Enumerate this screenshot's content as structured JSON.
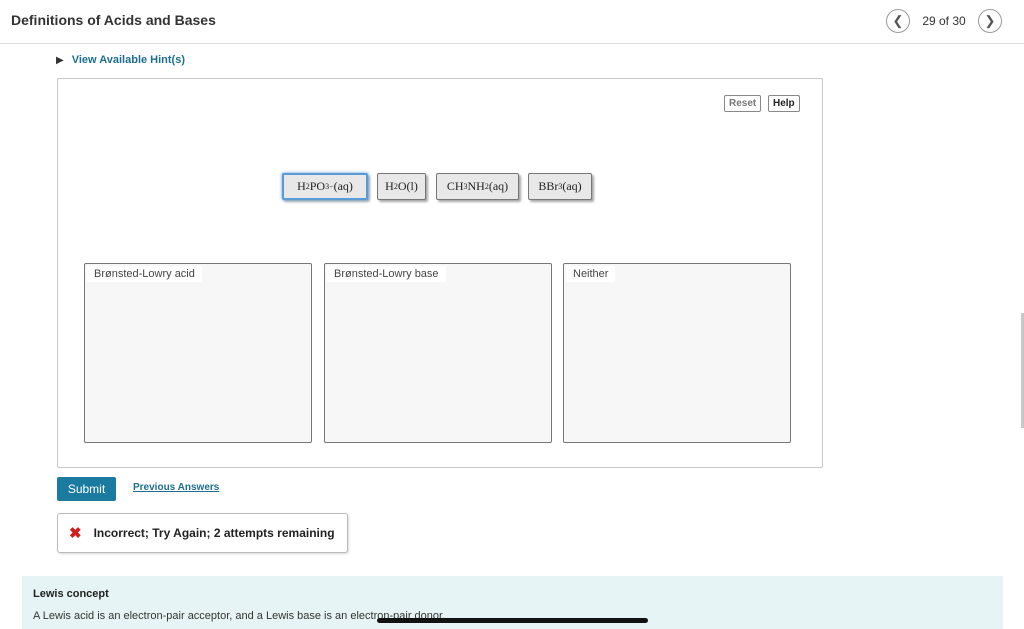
{
  "header": {
    "title": "Definitions of Acids and Bases",
    "page_count": "29 of 30",
    "prev_icon": "chevron-left-icon",
    "next_icon": "chevron-right-icon"
  },
  "hints": {
    "label": "View Available Hint(s)"
  },
  "workspace": {
    "reset_label": "Reset",
    "help_label": "Help",
    "chips": [
      {
        "base": "H",
        "sub1": "2",
        "mid": "PO",
        "sub2": "3",
        "sup": "−",
        "state": " (aq)"
      },
      {
        "base": "H",
        "sub1": "2",
        "mid": "O",
        "state": "(l)"
      },
      {
        "base": "CH",
        "sub1": "3",
        "mid": "NH",
        "sub2": "2",
        "state": "(aq)"
      },
      {
        "base": "BBr",
        "sub1": "3",
        "state": "(aq)"
      }
    ],
    "zones": [
      {
        "label": "Brønsted-Lowry acid"
      },
      {
        "label": "Brønsted-Lowry base"
      },
      {
        "label": "Neither"
      }
    ]
  },
  "actions": {
    "submit_label": "Submit",
    "previous_answers_label": "Previous Answers"
  },
  "feedback": {
    "icon": "x-icon",
    "message": "Incorrect; Try Again; 2 attempts remaining"
  },
  "info": {
    "title": "Lewis concept",
    "text": "A Lewis acid is an electron-pair acceptor, and a Lewis base is an electron-pair donor."
  },
  "colors": {
    "accent": "#1b7aa0",
    "link": "#1e6f8f",
    "error": "#cc1f1f",
    "info_bg": "#e6f4f5"
  }
}
